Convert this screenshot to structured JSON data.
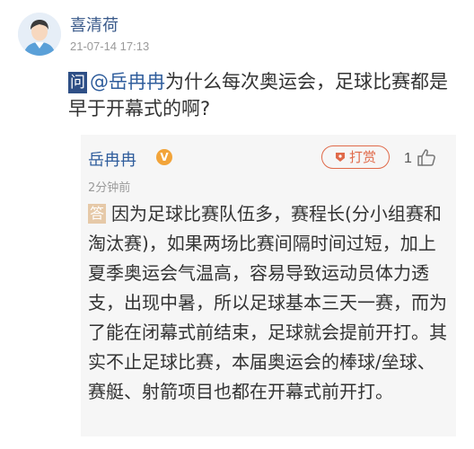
{
  "post": {
    "author": "喜清荷",
    "timestamp": "21-07-14 17:13",
    "question_badge": "问",
    "mention": "@岳冉冉",
    "question_text": "为什么每次奥运会，足球比赛都是早于开幕式的啊?"
  },
  "answer": {
    "author": "岳冉冉",
    "verified_icon": "v-badge-icon",
    "reward_label": "打赏",
    "like_count": "1",
    "time": "2分钟前",
    "answer_badge": "答",
    "text": "因为足球比赛队伍多，赛程长(分小组赛和淘汰赛)，如果两场比赛间隔时间过短，加上夏季奥运会气温高，容易导致运动员体力透支，出现中暑，所以足球基本三天一赛，而为了能在闭幕式前结束，足球就会提前开打。其实不止足球比赛，本届奥运会的棒球/垒球、赛艇、射箭项目也都在开幕式前开打。"
  },
  "colors": {
    "mention": "#2f5d9c",
    "q_badge": "#2e4f86",
    "reward": "#e06a4a",
    "a_badge": "#e6c9a8",
    "card_bg": "#f6f6f6"
  }
}
